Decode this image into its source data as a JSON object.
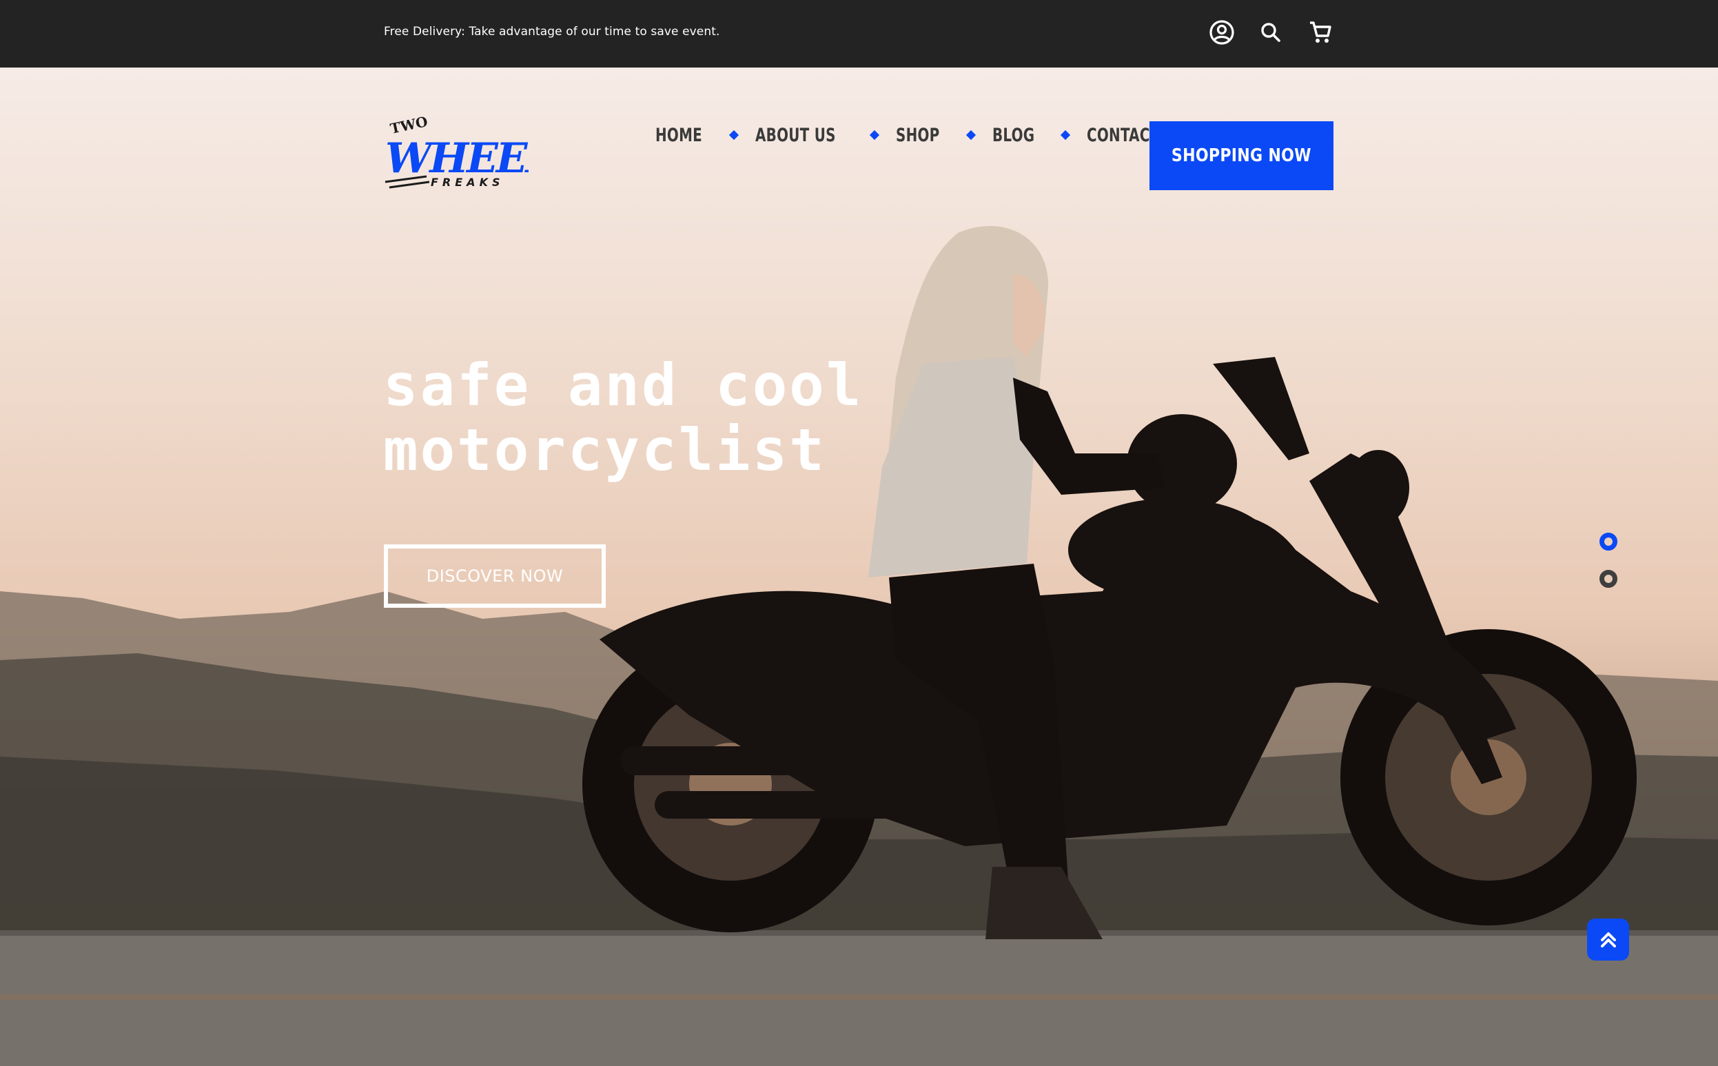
{
  "topbar": {
    "promo_text": "Free Delivery: Take advantage of our time to save event.",
    "icons": [
      "account-icon",
      "search-icon",
      "cart-icon"
    ]
  },
  "logo": {
    "line1": "TWO",
    "line2": "WHEELS",
    "line3": "FREAKS"
  },
  "nav": {
    "items": [
      "HOME",
      "ABOUT US",
      "SHOP",
      "BLOG",
      "CONTACT"
    ],
    "cta_label": "SHOPPING NOW"
  },
  "hero": {
    "headline_line1": "safe and cool",
    "headline_line2": "motorcyclist",
    "button_label": "DISCOVER NOW",
    "slides_total": 2,
    "active_slide": 1
  },
  "colors": {
    "accent": "#0a49f5",
    "topbar_bg": "#232323",
    "nav_text": "#3a3a3a",
    "white": "#ffffff"
  }
}
